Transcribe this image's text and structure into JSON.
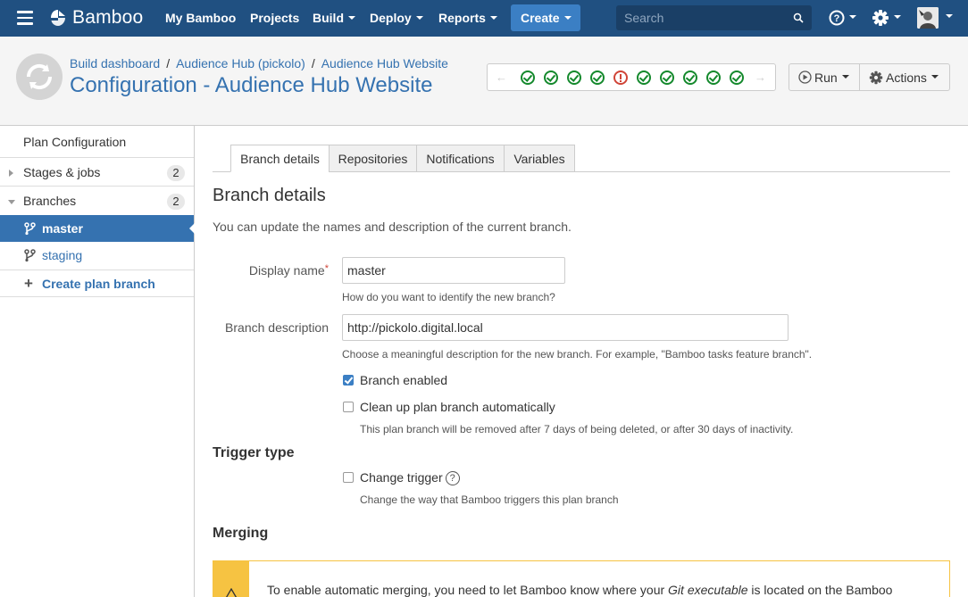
{
  "topnav": {
    "brand": "Bamboo",
    "items": [
      {
        "label": "My Bamboo"
      },
      {
        "label": "Projects"
      },
      {
        "label": "Build"
      },
      {
        "label": "Deploy"
      },
      {
        "label": "Reports"
      }
    ],
    "create_label": "Create",
    "search_placeholder": "Search",
    "icons": [
      "menu-icon",
      "bamboo-logo",
      "search-icon",
      "help-icon",
      "gear-icon",
      "avatar"
    ]
  },
  "header": {
    "breadcrumbs": [
      "Build dashboard",
      "Audience Hub (pickolo)",
      "Audience Hub Website"
    ],
    "title": "Configuration - Audience Hub Website",
    "build_history": [
      "success",
      "success",
      "success",
      "success",
      "failed",
      "success",
      "success",
      "success",
      "success",
      "success"
    ],
    "run_label": "Run",
    "actions_label": "Actions"
  },
  "sidebar": {
    "plan_configuration": "Plan Configuration",
    "stages_label": "Stages & jobs",
    "stages_count": "2",
    "branches_label": "Branches",
    "branches_count": "2",
    "branches": [
      {
        "label": "master",
        "active": true
      },
      {
        "label": "staging",
        "active": false
      }
    ],
    "create_branch": "Create plan branch"
  },
  "main": {
    "tabs": [
      {
        "label": "Branch details",
        "active": true
      },
      {
        "label": "Repositories",
        "active": false
      },
      {
        "label": "Notifications",
        "active": false
      },
      {
        "label": "Variables",
        "active": false
      }
    ],
    "section_title": "Branch details",
    "section_desc": "You can update the names and description of the current branch.",
    "display_name_label": "Display name",
    "display_name_value": "master",
    "display_name_hint": "How do you want to identify the new branch?",
    "branch_desc_label": "Branch description",
    "branch_desc_value": "http://pickolo.digital.local",
    "branch_desc_hint": "Choose a meaningful description for the new branch. For example, \"Bamboo tasks feature branch\".",
    "branch_enabled_label": "Branch enabled",
    "branch_enabled": true,
    "cleanup_label": "Clean up plan branch automatically",
    "cleanup_enabled": false,
    "cleanup_hint": "This plan branch will be removed after 7 days of being deleted, or after 30 days of inactivity.",
    "trigger_title": "Trigger type",
    "change_trigger_label": "Change trigger",
    "change_trigger_enabled": false,
    "change_trigger_hint": "Change the way that Bamboo triggers this plan branch",
    "merging_title": "Merging",
    "warning_text_pre": "To enable automatic merging, you need to let Bamboo know where your ",
    "warning_text_em": "Git executable",
    "warning_text_post": " is located on the Bamboo"
  },
  "colors": {
    "nav_bg": "#205081",
    "create_bg": "#3b7fc4",
    "link": "#3572b0",
    "success": "#14892c",
    "failed": "#d04437",
    "warning": "#f6c342"
  }
}
